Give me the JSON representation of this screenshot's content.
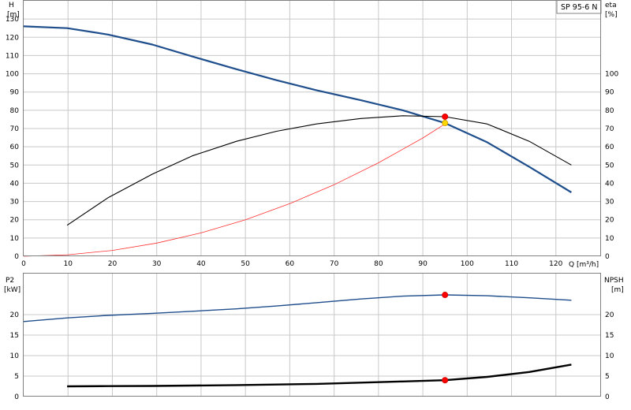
{
  "chart_data": [
    {
      "type": "line",
      "model": "SP 95-6 N",
      "x_axis": {
        "label": "Q [m³/h]",
        "range": [
          0,
          130
        ],
        "ticks": [
          "0",
          "10",
          "20",
          "30",
          "40",
          "50",
          "60",
          "70",
          "80",
          "90",
          "100",
          "110",
          "120"
        ]
      },
      "left_axis": {
        "label_line1": "H",
        "label_line2": "[m]",
        "range": [
          0,
          140
        ],
        "ticks": [
          "0",
          "10",
          "20",
          "30",
          "40",
          "50",
          "60",
          "70",
          "80",
          "90",
          "100",
          "110",
          "120",
          "130"
        ]
      },
      "right_axis": {
        "label_line1": "eta",
        "label_line2": "[%]",
        "range": [
          0,
          140
        ],
        "ticks": [
          "0",
          "10",
          "20",
          "30",
          "40",
          "50",
          "60",
          "70",
          "80",
          "90",
          "100"
        ]
      },
      "grid": true,
      "series": [
        {
          "id": "head",
          "axis": "left",
          "color": "#1f4e8c",
          "x": [
            0,
            9.8,
            19,
            29,
            38,
            48,
            57,
            66,
            76,
            85.5,
            95,
            104.5,
            114,
            123.5
          ],
          "y": [
            126,
            125,
            121.5,
            116,
            109.5,
            102.5,
            96.5,
            91,
            85.5,
            80,
            73,
            62.5,
            49,
            35
          ]
        },
        {
          "id": "efficiency",
          "axis": "right",
          "color": "#000000",
          "x": [
            9.8,
            19,
            29,
            38,
            48,
            57,
            66,
            76,
            85.5,
            95,
            104.5,
            114,
            123.5
          ],
          "y": [
            17,
            32,
            45,
            55,
            63,
            68.5,
            72.5,
            75.5,
            77,
            76.5,
            72.5,
            63,
            50
          ]
        },
        {
          "id": "system-curve",
          "axis": "left",
          "color": "#ff3030",
          "x": [
            0,
            10,
            20,
            30,
            40,
            50,
            60,
            70,
            80,
            90,
            95
          ],
          "y": [
            0,
            0.8,
            3.2,
            7.2,
            12.8,
            20,
            28.8,
            39.2,
            51.2,
            64.8,
            72.5
          ]
        }
      ],
      "markers": [
        {
          "id": "duty-point-efficiency",
          "axis": "right",
          "x": 95,
          "y": 76.5,
          "fill": "#ff0000",
          "stroke": "#cc0000"
        },
        {
          "id": "duty-point-head",
          "axis": "left",
          "x": 95,
          "y": 73,
          "fill": "#ffd700",
          "stroke": "#cc9900"
        }
      ]
    },
    {
      "type": "line",
      "x_axis": {
        "range": [
          0,
          130
        ]
      },
      "left_axis": {
        "label_line1": "P2",
        "label_line2": "[kW]",
        "range": [
          0,
          30
        ],
        "ticks": [
          "0",
          "5",
          "10",
          "15",
          "20"
        ]
      },
      "right_axis": {
        "label_line1": "NPSH",
        "label_line2": "[m]",
        "range": [
          0,
          30
        ],
        "ticks": [
          "0",
          "5",
          "10",
          "15",
          "20"
        ]
      },
      "grid": true,
      "series": [
        {
          "id": "power-p2",
          "axis": "left",
          "color": "#1f4e8c",
          "x": [
            0,
            9.8,
            19,
            29,
            38,
            48,
            57,
            66,
            76,
            85.5,
            95,
            104.5,
            114,
            123.5
          ],
          "y": [
            18.3,
            19.2,
            19.8,
            20.3,
            20.8,
            21.4,
            22.1,
            22.9,
            23.8,
            24.5,
            24.8,
            24.6,
            24.1,
            23.5
          ]
        },
        {
          "id": "npsh",
          "axis": "right",
          "color": "#000000",
          "x": [
            9.8,
            19,
            29,
            38,
            48,
            57,
            66,
            76,
            85.5,
            95,
            104.5,
            114,
            123.5
          ],
          "y": [
            2.5,
            2.55,
            2.6,
            2.7,
            2.8,
            2.95,
            3.1,
            3.4,
            3.7,
            4.0,
            4.8,
            6.0,
            7.8
          ]
        }
      ],
      "markers": [
        {
          "id": "duty-point-power",
          "axis": "left",
          "x": 95,
          "y": 24.8,
          "fill": "#ff0000",
          "stroke": "#cc0000"
        },
        {
          "id": "duty-point-npsh",
          "axis": "right",
          "x": 95,
          "y": 4.0,
          "fill": "#ff0000",
          "stroke": "#cc0000"
        }
      ]
    }
  ]
}
